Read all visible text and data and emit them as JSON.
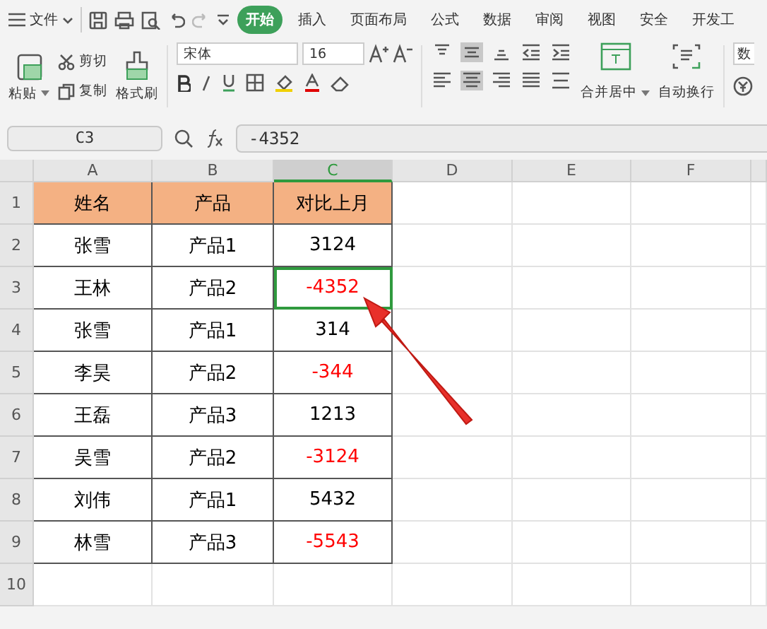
{
  "menu": {
    "file": "文件",
    "tabs": [
      {
        "label": "开始",
        "selected": true
      },
      {
        "label": "插入",
        "selected": false
      },
      {
        "label": "页面布局",
        "selected": false
      },
      {
        "label": "公式",
        "selected": false
      },
      {
        "label": "数据",
        "selected": false
      },
      {
        "label": "审阅",
        "selected": false
      },
      {
        "label": "视图",
        "selected": false
      },
      {
        "label": "安全",
        "selected": false
      },
      {
        "label": "开发工",
        "selected": false
      }
    ]
  },
  "ribbon": {
    "paste": "粘贴",
    "cut": "剪切",
    "copy": "复制",
    "format_painter": "格式刷",
    "font_name": "宋体",
    "font_size": "16",
    "merge": "合并居中",
    "wrap": "自动换行",
    "number_format": "数"
  },
  "formula_bar": {
    "name_box": "C3",
    "formula": "-4352"
  },
  "sheet": {
    "columns": [
      {
        "label": "A",
        "selected": false
      },
      {
        "label": "B",
        "selected": false
      },
      {
        "label": "C",
        "selected": true
      },
      {
        "label": "D",
        "selected": false
      },
      {
        "label": "E",
        "selected": false
      },
      {
        "label": "F",
        "selected": false
      }
    ],
    "row_numbers": [
      "1",
      "2",
      "3",
      "4",
      "5",
      "6",
      "7",
      "8",
      "9",
      "10"
    ],
    "rows": [
      [
        {
          "text": "姓名",
          "kind": "header",
          "selected": false
        },
        {
          "text": "产品",
          "kind": "header",
          "selected": false
        },
        {
          "text": "对比上月",
          "kind": "header",
          "selected": false
        }
      ],
      [
        {
          "text": "张雪",
          "kind": "data",
          "color": "#000000",
          "selected": false
        },
        {
          "text": "产品1",
          "kind": "data",
          "color": "#000000",
          "selected": false
        },
        {
          "text": "3124",
          "kind": "data",
          "color": "#000000",
          "selected": false
        }
      ],
      [
        {
          "text": "王林",
          "kind": "data",
          "color": "#000000",
          "selected": false
        },
        {
          "text": "产品2",
          "kind": "data",
          "color": "#000000",
          "selected": false
        },
        {
          "text": "-4352",
          "kind": "data",
          "color": "#ff0000",
          "selected": true
        }
      ],
      [
        {
          "text": "张雪",
          "kind": "data",
          "color": "#000000",
          "selected": false
        },
        {
          "text": "产品1",
          "kind": "data",
          "color": "#000000",
          "selected": false
        },
        {
          "text": "314",
          "kind": "data",
          "color": "#000000",
          "selected": false
        }
      ],
      [
        {
          "text": "李昊",
          "kind": "data",
          "color": "#000000",
          "selected": false
        },
        {
          "text": "产品2",
          "kind": "data",
          "color": "#000000",
          "selected": false
        },
        {
          "text": "-344",
          "kind": "data",
          "color": "#ff0000",
          "selected": false
        }
      ],
      [
        {
          "text": "王磊",
          "kind": "data",
          "color": "#000000",
          "selected": false
        },
        {
          "text": "产品3",
          "kind": "data",
          "color": "#000000",
          "selected": false
        },
        {
          "text": "1213",
          "kind": "data",
          "color": "#000000",
          "selected": false
        }
      ],
      [
        {
          "text": "吴雪",
          "kind": "data",
          "color": "#000000",
          "selected": false
        },
        {
          "text": "产品2",
          "kind": "data",
          "color": "#000000",
          "selected": false
        },
        {
          "text": "-3124",
          "kind": "data",
          "color": "#ff0000",
          "selected": false
        }
      ],
      [
        {
          "text": "刘伟",
          "kind": "data",
          "color": "#000000",
          "selected": false
        },
        {
          "text": "产品1",
          "kind": "data",
          "color": "#000000",
          "selected": false
        },
        {
          "text": "5432",
          "kind": "data",
          "color": "#000000",
          "selected": false
        }
      ],
      [
        {
          "text": "林雪",
          "kind": "data",
          "color": "#000000",
          "selected": false
        },
        {
          "text": "产品3",
          "kind": "data",
          "color": "#000000",
          "selected": false
        },
        {
          "text": "-5543",
          "kind": "data",
          "color": "#ff0000",
          "selected": false
        }
      ]
    ]
  }
}
